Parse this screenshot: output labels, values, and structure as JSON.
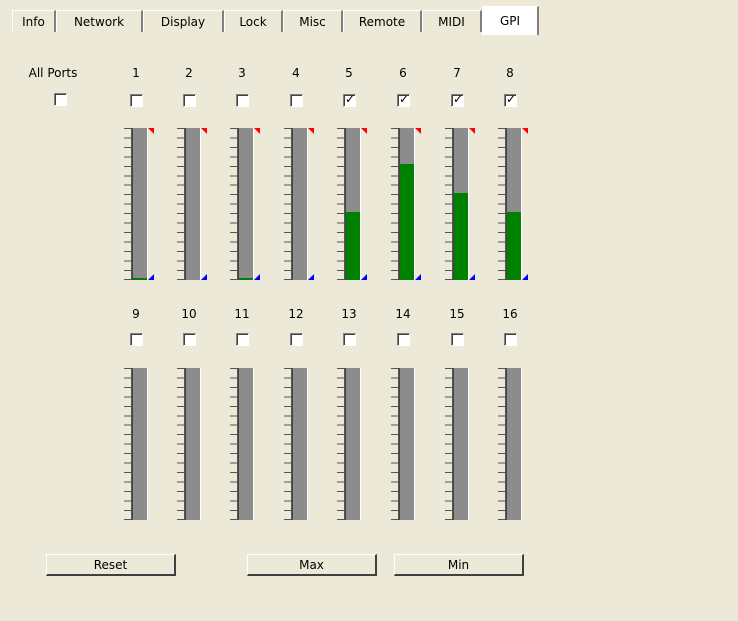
{
  "tabs": [
    "Info",
    "Network",
    "Display",
    "Lock",
    "Misc",
    "Remote",
    "MIDI",
    "GPI"
  ],
  "active_tab": "GPI",
  "all_ports": {
    "label": "All Ports",
    "checked": false
  },
  "ports": [
    {
      "label": "1",
      "checked": false,
      "level": 0.01
    },
    {
      "label": "2",
      "checked": false,
      "level": 0
    },
    {
      "label": "3",
      "checked": false,
      "level": 0.01
    },
    {
      "label": "4",
      "checked": false,
      "level": 0
    },
    {
      "label": "5",
      "checked": true,
      "level": 0.45
    },
    {
      "label": "6",
      "checked": true,
      "level": 0.76
    },
    {
      "label": "7",
      "checked": true,
      "level": 0.57
    },
    {
      "label": "8",
      "checked": true,
      "level": 0.45
    },
    {
      "label": "9",
      "checked": false,
      "level": 0
    },
    {
      "label": "10",
      "checked": false,
      "level": 0
    },
    {
      "label": "11",
      "checked": false,
      "level": 0
    },
    {
      "label": "12",
      "checked": false,
      "level": 0
    },
    {
      "label": "13",
      "checked": false,
      "level": 0
    },
    {
      "label": "14",
      "checked": false,
      "level": 0
    },
    {
      "label": "15",
      "checked": false,
      "level": 0
    },
    {
      "label": "16",
      "checked": false,
      "level": 0
    }
  ],
  "buttons": {
    "reset": "Reset",
    "max": "Max",
    "min": "Min"
  },
  "colors": {
    "meter_fill": "#008000",
    "meter_bg": "#8c8c8c",
    "max_marker": "#ff0000",
    "min_marker": "#0000ff"
  }
}
